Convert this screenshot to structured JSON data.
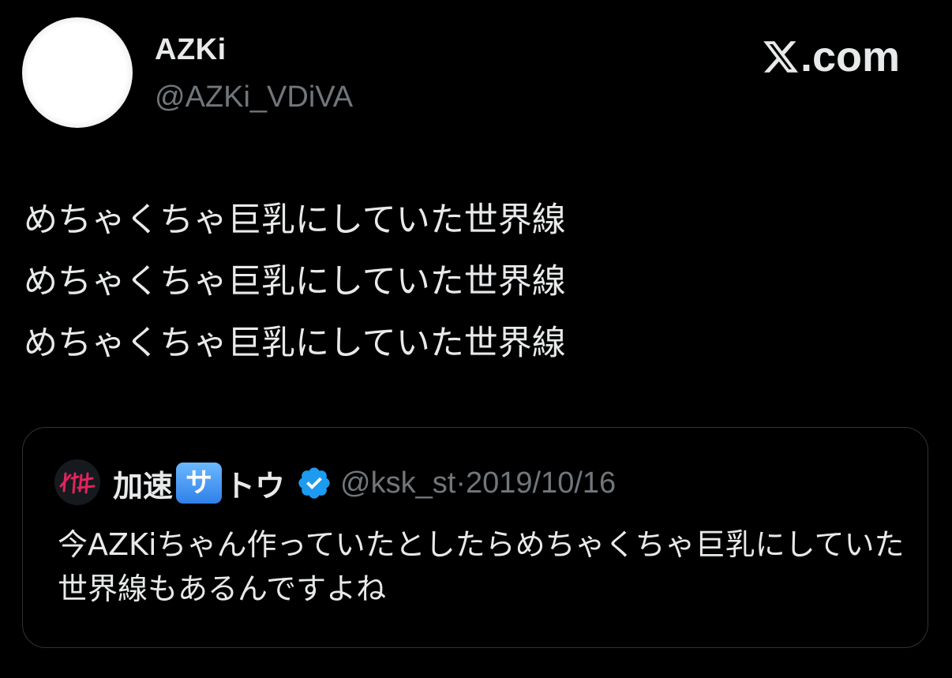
{
  "author": {
    "display_name": "AZKi",
    "handle": "@AZKi_VDiVA",
    "avatar_icon": "profile-avatar"
  },
  "brand": {
    "label": ".com",
    "icon": "x-logo-icon"
  },
  "tweet": {
    "lines": [
      "めちゃくちゃ巨乳にしていた世界線",
      "めちゃくちゃ巨乳にしていた世界線",
      "めちゃくちゃ巨乳にしていた世界線"
    ]
  },
  "quote": {
    "name_part1": "加速",
    "name_badge": "サ",
    "name_part2": "トウ",
    "verified_icon": "verified-badge-icon",
    "verified_color": "#1d9bf0",
    "handle": "@ksk_st",
    "separator": "·",
    "date": "2019/10/16",
    "text": "今AZKiちゃん作っていたとしたらめちゃくちゃ巨乳にしていた世界線もあるんですよね"
  },
  "colors": {
    "background": "#000000",
    "text": "#e7e9ea",
    "muted": "#71767b",
    "border": "#2f3336"
  }
}
